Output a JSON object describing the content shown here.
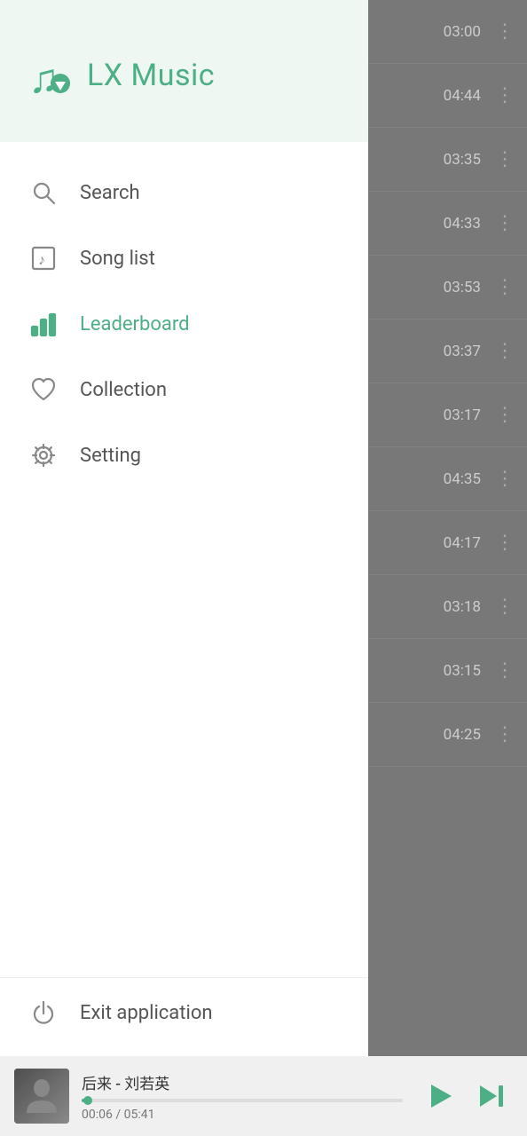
{
  "app": {
    "name": "LX Music",
    "icon": "music-note"
  },
  "sidebar": {
    "nav_items": [
      {
        "id": "search",
        "label": "Search",
        "icon": "search",
        "active": false
      },
      {
        "id": "songlist",
        "label": "Song list",
        "icon": "songlist",
        "active": false
      },
      {
        "id": "leaderboard",
        "label": "Leaderboard",
        "icon": "leaderboard",
        "active": true
      },
      {
        "id": "collection",
        "label": "Collection",
        "icon": "heart",
        "active": false
      },
      {
        "id": "setting",
        "label": "Setting",
        "icon": "gear",
        "active": false
      }
    ],
    "footer": {
      "label": "Exit application",
      "icon": "power"
    }
  },
  "song_list": {
    "songs": [
      {
        "duration": "03:00"
      },
      {
        "duration": "04:44"
      },
      {
        "duration": "03:35"
      },
      {
        "duration": "04:33"
      },
      {
        "duration": "03:53"
      },
      {
        "duration": "03:37"
      },
      {
        "duration": "03:17"
      },
      {
        "duration": "04:35"
      },
      {
        "duration": "04:17"
      },
      {
        "duration": "03:18"
      },
      {
        "duration": "03:15"
      },
      {
        "duration": "04:25"
      }
    ]
  },
  "player": {
    "song_title": "后来 - 刘若英",
    "current_time": "00:06",
    "total_time": "05:41",
    "progress_percent": 2,
    "accent_color": "#4caf85"
  }
}
